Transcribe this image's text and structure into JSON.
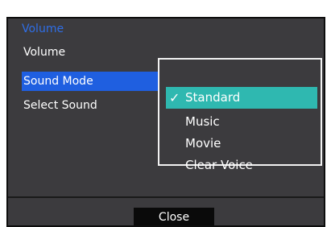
{
  "menu": {
    "title": "Volume",
    "items": [
      {
        "label": "Volume"
      },
      {
        "label": "Sound Mode"
      },
      {
        "label": "Select Sound"
      }
    ]
  },
  "sound_mode_popup": {
    "selected": "Standard",
    "options": [
      {
        "label": "Standard"
      },
      {
        "label": "Music"
      },
      {
        "label": "Movie"
      },
      {
        "label": "Clear Voice"
      }
    ],
    "check_icon": "✓"
  },
  "footer": {
    "close_label": "Close"
  },
  "colors": {
    "panel_bg": "#3c3b3e",
    "title": "#2f6ee6",
    "menu_highlight": "#1f5fe0",
    "option_highlight": "#2fb8b0",
    "close_button_bg": "#0a0a0a"
  }
}
